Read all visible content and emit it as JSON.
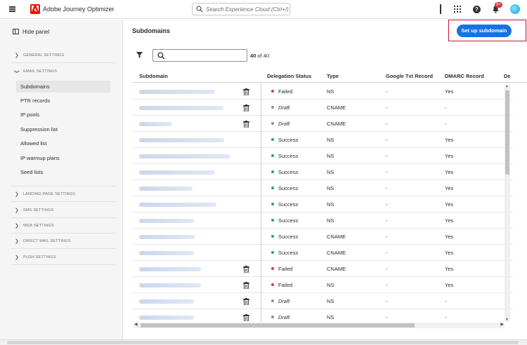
{
  "app": {
    "title": "Adobe Journey Optimizer",
    "search_placeholder": "Search Experience Cloud (Ctrl+/)",
    "notifications_count": "9+"
  },
  "sidebar": {
    "hide_panel": "Hide panel",
    "sections": [
      {
        "label": "GENERAL SETTINGS",
        "expanded": false
      },
      {
        "label": "EMAIL SETTINGS",
        "expanded": true
      },
      {
        "label": "LANDING PAGE SETTINGS",
        "expanded": false
      },
      {
        "label": "SMS SETTINGS",
        "expanded": false
      },
      {
        "label": "WEB SETTINGS",
        "expanded": false
      },
      {
        "label": "DIRECT MAIL SETTINGS",
        "expanded": false
      },
      {
        "label": "PUSH SETTINGS",
        "expanded": false
      }
    ],
    "email_items": [
      "Subdomains",
      "PTR records",
      "IP pools",
      "Suppression list",
      "Allowed list",
      "IP warmup plans",
      "Seed lists"
    ],
    "active_item": "Subdomains"
  },
  "main": {
    "title": "Subdomains",
    "cta_label": "Set up subdomain",
    "count_value": "40",
    "count_suffix": " of 40",
    "columns": [
      "Subdomain",
      "Delegation Status",
      "Type",
      "Google Txt Record",
      "DMARC Record",
      "De"
    ]
  },
  "colors": {
    "failed": "#d7373f",
    "success": "#2d9d78",
    "draft": "#8e8e8e",
    "accent": "#1473e6",
    "highlight_border": "#c8102e"
  },
  "rows": [
    {
      "status": "Failed",
      "type": "NS",
      "google": "-",
      "dmarc": "Yes",
      "trash": true
    },
    {
      "status": "Draft",
      "type": "CNAME",
      "google": "-",
      "dmarc": "-",
      "trash": true
    },
    {
      "status": "Draft",
      "type": "CNAME",
      "google": "-",
      "dmarc": "-",
      "trash": true
    },
    {
      "status": "Success",
      "type": "NS",
      "google": "-",
      "dmarc": "Yes",
      "trash": false
    },
    {
      "status": "Success",
      "type": "NS",
      "google": "-",
      "dmarc": "Yes",
      "trash": false
    },
    {
      "status": "Success",
      "type": "NS",
      "google": "-",
      "dmarc": "Yes",
      "trash": false
    },
    {
      "status": "Success",
      "type": "NS",
      "google": "-",
      "dmarc": "Yes",
      "trash": false
    },
    {
      "status": "Success",
      "type": "NS",
      "google": "-",
      "dmarc": "Yes",
      "trash": false
    },
    {
      "status": "Success",
      "type": "NS",
      "google": "-",
      "dmarc": "Yes",
      "trash": false
    },
    {
      "status": "Success",
      "type": "CNAME",
      "google": "-",
      "dmarc": "Yes",
      "trash": false
    },
    {
      "status": "Success",
      "type": "CNAME",
      "google": "-",
      "dmarc": "Yes",
      "trash": false
    },
    {
      "status": "Failed",
      "type": "CNAME",
      "google": "-",
      "dmarc": "Yes",
      "trash": true
    },
    {
      "status": "Failed",
      "type": "NS",
      "google": "-",
      "dmarc": "Yes",
      "trash": true
    },
    {
      "status": "Draft",
      "type": "NS",
      "google": "-",
      "dmarc": "-",
      "trash": true
    },
    {
      "status": "Draft",
      "type": "NS",
      "google": "-",
      "dmarc": "-",
      "trash": true
    }
  ]
}
